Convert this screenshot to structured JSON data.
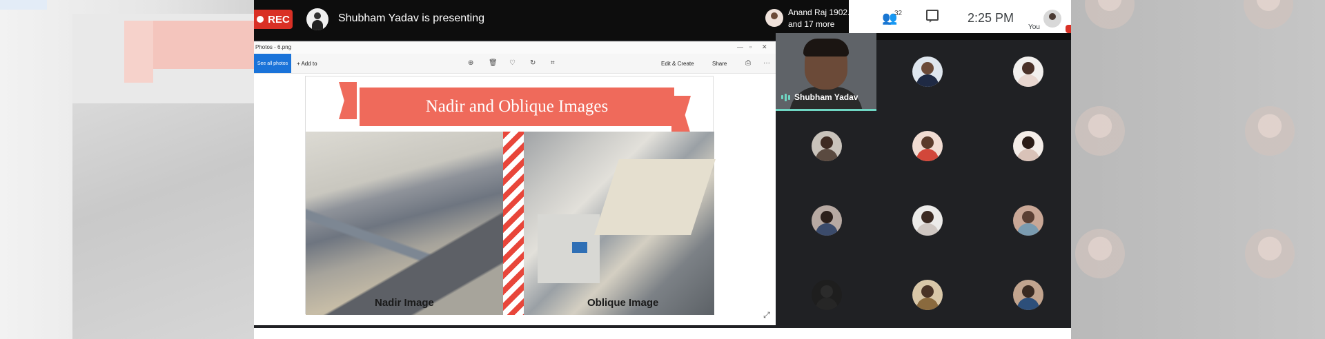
{
  "recording": {
    "label": "REC"
  },
  "presenter": {
    "text": "Shubham Yadav is presenting"
  },
  "photos_window": {
    "title": "Photos - 6.png",
    "see_all": "See all photos",
    "add_to": "+ Add to",
    "edit_create": "Edit & Create",
    "share": "Share",
    "more": "···"
  },
  "slide": {
    "title": "Nadir and Oblique Images",
    "caption_left": "Nadir Image",
    "caption_right": "Oblique Image"
  },
  "header": {
    "participant_name": "Anand Raj 1902...",
    "participant_more": "and 17 more",
    "people_count": "32",
    "time": "2:25 PM",
    "you_label": "You"
  },
  "self_tile": {
    "name": "Shubham Yadav"
  },
  "colors": {
    "rec": "#d93025",
    "accent": "#6fd6c3",
    "banner": "#ef6a5b"
  }
}
